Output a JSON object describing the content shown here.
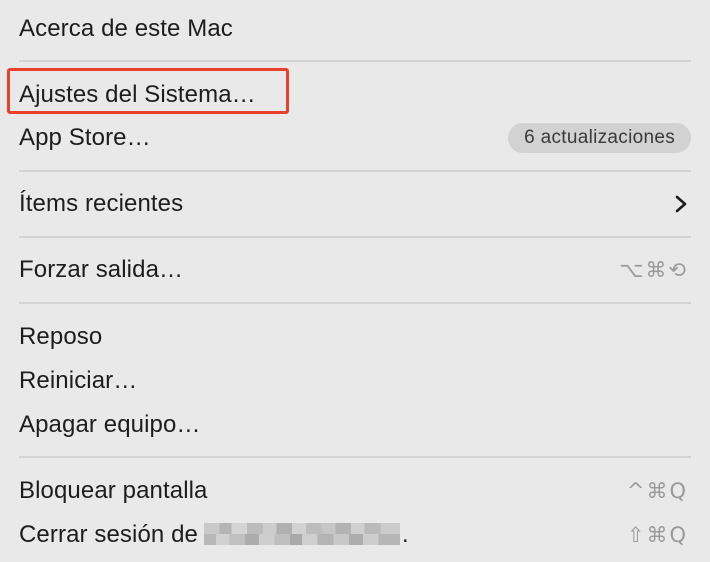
{
  "menu": {
    "about": "Acerca de este Mac",
    "settings": "Ajustes del Sistema…",
    "app_store": "App Store…",
    "app_store_badge": "6 actualizaciones",
    "recent_items": "Ítems recientes",
    "force_quit": "Forzar salida…",
    "force_quit_shortcut": "⌥⌘⟲",
    "sleep": "Reposo",
    "restart": "Reiniciar…",
    "shut_down": "Apagar equipo…",
    "lock_screen": "Bloquear pantalla",
    "lock_screen_shortcut": "^⌘Q",
    "log_out_prefix": "Cerrar sesión de",
    "log_out_suffix": ".",
    "log_out_shortcut": "⇧⌘Q"
  },
  "colors": {
    "background": "#e9e9e9",
    "highlight_border": "#e8402a",
    "badge_background": "#d2d2d2",
    "shortcut_text": "#9a9a9a"
  },
  "icons": {
    "submenu": "chevron-right-icon"
  }
}
